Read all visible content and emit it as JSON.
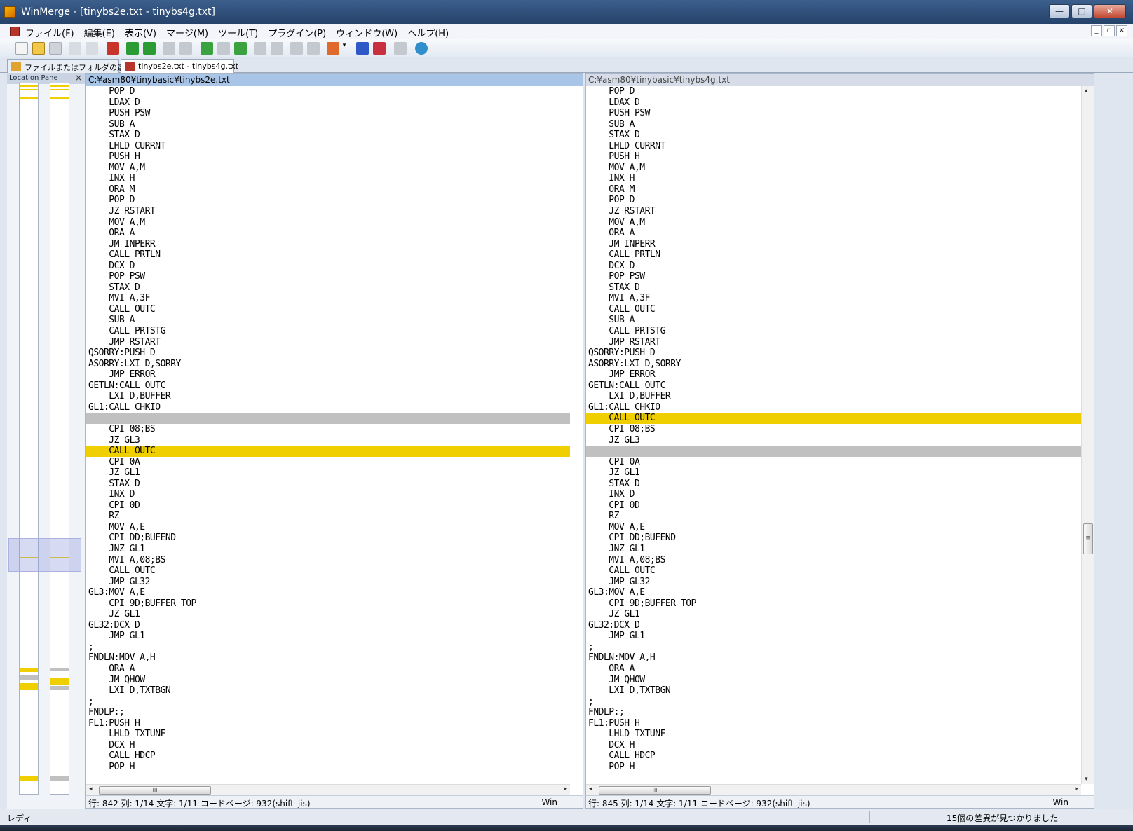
{
  "window": {
    "title": "WinMerge - [tinybs2e.txt - tinybs4g.txt]",
    "minimize": "—",
    "maximize": "□",
    "close": "✕"
  },
  "menu": [
    "ファイル(F)",
    "編集(E)",
    "表示(V)",
    "マージ(M)",
    "ツール(T)",
    "プラグイン(P)",
    "ウィンドウ(W)",
    "ヘルプ(H)"
  ],
  "mdi_buttons": [
    "_",
    "▫",
    "×"
  ],
  "tabs": [
    {
      "label": "ファイルまたはフォルダの選択...",
      "active": false
    },
    {
      "label": "tinybs2e.txt - tinybs4g.txt",
      "active": true
    }
  ],
  "location_pane": {
    "title": "Location Pane",
    "close": "×"
  },
  "left": {
    "path": "C:¥asm80¥tinybasic¥tinybs2e.txt",
    "status": "行: 842  列: 1/14  文字: 1/11  コードページ: 932(shift_jis)",
    "eol": "Win",
    "lines": [
      {
        "t": "    POP D",
        "s": ""
      },
      {
        "t": "    LDAX D",
        "s": ""
      },
      {
        "t": "    PUSH PSW",
        "s": ""
      },
      {
        "t": "    SUB A",
        "s": ""
      },
      {
        "t": "    STAX D",
        "s": ""
      },
      {
        "t": "    LHLD CURRNT",
        "s": ""
      },
      {
        "t": "    PUSH H",
        "s": ""
      },
      {
        "t": "    MOV A,M",
        "s": ""
      },
      {
        "t": "    INX H",
        "s": ""
      },
      {
        "t": "    ORA M",
        "s": ""
      },
      {
        "t": "    POP D",
        "s": ""
      },
      {
        "t": "    JZ RSTART",
        "s": ""
      },
      {
        "t": "    MOV A,M",
        "s": ""
      },
      {
        "t": "    ORA A",
        "s": ""
      },
      {
        "t": "    JM INPERR",
        "s": ""
      },
      {
        "t": "    CALL PRTLN",
        "s": ""
      },
      {
        "t": "    DCX D",
        "s": ""
      },
      {
        "t": "    POP PSW",
        "s": ""
      },
      {
        "t": "    STAX D",
        "s": ""
      },
      {
        "t": "    MVI A,3F",
        "s": ""
      },
      {
        "t": "    CALL OUTC",
        "s": ""
      },
      {
        "t": "    SUB A",
        "s": ""
      },
      {
        "t": "    CALL PRTSTG",
        "s": ""
      },
      {
        "t": "    JMP RSTART",
        "s": ""
      },
      {
        "t": "QSORRY:PUSH D",
        "s": ""
      },
      {
        "t": "ASORRY:LXI D,SORRY",
        "s": ""
      },
      {
        "t": "    JMP ERROR",
        "s": ""
      },
      {
        "t": "GETLN:CALL OUTC",
        "s": ""
      },
      {
        "t": "    LXI D,BUFFER",
        "s": ""
      },
      {
        "t": "GL1:CALL CHKIO",
        "s": ""
      },
      {
        "t": "",
        "s": "empty"
      },
      {
        "t": "    CPI 08;BS",
        "s": ""
      },
      {
        "t": "    JZ GL3",
        "s": ""
      },
      {
        "t": "    CALL OUTC",
        "s": "changed"
      },
      {
        "t": "    CPI 0A",
        "s": ""
      },
      {
        "t": "    JZ GL1",
        "s": ""
      },
      {
        "t": "    STAX D",
        "s": ""
      },
      {
        "t": "    INX D",
        "s": ""
      },
      {
        "t": "    CPI 0D",
        "s": ""
      },
      {
        "t": "    RZ",
        "s": ""
      },
      {
        "t": "    MOV A,E",
        "s": ""
      },
      {
        "t": "    CPI DD;BUFEND",
        "s": ""
      },
      {
        "t": "    JNZ GL1",
        "s": ""
      },
      {
        "t": "    MVI A,08;BS",
        "s": ""
      },
      {
        "t": "    CALL OUTC",
        "s": ""
      },
      {
        "t": "    JMP GL32",
        "s": ""
      },
      {
        "t": "GL3:MOV A,E",
        "s": ""
      },
      {
        "t": "    CPI 9D;BUFFER TOP",
        "s": ""
      },
      {
        "t": "    JZ GL1",
        "s": ""
      },
      {
        "t": "GL32:DCX D",
        "s": ""
      },
      {
        "t": "    JMP GL1",
        "s": ""
      },
      {
        "t": ";",
        "s": ""
      },
      {
        "t": "FNDLN:MOV A,H",
        "s": ""
      },
      {
        "t": "    ORA A",
        "s": ""
      },
      {
        "t": "    JM QHOW",
        "s": ""
      },
      {
        "t": "    LXI D,TXTBGN",
        "s": ""
      },
      {
        "t": ";",
        "s": ""
      },
      {
        "t": "FNDLP:;",
        "s": ""
      },
      {
        "t": "FL1:PUSH H",
        "s": ""
      },
      {
        "t": "    LHLD TXTUNF",
        "s": ""
      },
      {
        "t": "    DCX H",
        "s": ""
      },
      {
        "t": "    CALL HDCP",
        "s": ""
      },
      {
        "t": "    POP H",
        "s": ""
      }
    ]
  },
  "right": {
    "path": "C:¥asm80¥tinybasic¥tinybs4g.txt",
    "status": "行: 845  列: 1/14  文字: 1/11  コードページ: 932(shift_jis)",
    "eol": "Win",
    "lines": [
      {
        "t": "    POP D",
        "s": ""
      },
      {
        "t": "    LDAX D",
        "s": ""
      },
      {
        "t": "    PUSH PSW",
        "s": ""
      },
      {
        "t": "    SUB A",
        "s": ""
      },
      {
        "t": "    STAX D",
        "s": ""
      },
      {
        "t": "    LHLD CURRNT",
        "s": ""
      },
      {
        "t": "    PUSH H",
        "s": ""
      },
      {
        "t": "    MOV A,M",
        "s": ""
      },
      {
        "t": "    INX H",
        "s": ""
      },
      {
        "t": "    ORA M",
        "s": ""
      },
      {
        "t": "    POP D",
        "s": ""
      },
      {
        "t": "    JZ RSTART",
        "s": ""
      },
      {
        "t": "    MOV A,M",
        "s": ""
      },
      {
        "t": "    ORA A",
        "s": ""
      },
      {
        "t": "    JM INPERR",
        "s": ""
      },
      {
        "t": "    CALL PRTLN",
        "s": ""
      },
      {
        "t": "    DCX D",
        "s": ""
      },
      {
        "t": "    POP PSW",
        "s": ""
      },
      {
        "t": "    STAX D",
        "s": ""
      },
      {
        "t": "    MVI A,3F",
        "s": ""
      },
      {
        "t": "    CALL OUTC",
        "s": ""
      },
      {
        "t": "    SUB A",
        "s": ""
      },
      {
        "t": "    CALL PRTSTG",
        "s": ""
      },
      {
        "t": "    JMP RSTART",
        "s": ""
      },
      {
        "t": "QSORRY:PUSH D",
        "s": ""
      },
      {
        "t": "ASORRY:LXI D,SORRY",
        "s": ""
      },
      {
        "t": "    JMP ERROR",
        "s": ""
      },
      {
        "t": "GETLN:CALL OUTC",
        "s": ""
      },
      {
        "t": "    LXI D,BUFFER",
        "s": ""
      },
      {
        "t": "GL1:CALL CHKIO",
        "s": ""
      },
      {
        "t": "    CALL OUTC",
        "s": "changed"
      },
      {
        "t": "    CPI 08;BS",
        "s": ""
      },
      {
        "t": "    JZ GL3",
        "s": ""
      },
      {
        "t": "",
        "s": "empty"
      },
      {
        "t": "    CPI 0A",
        "s": ""
      },
      {
        "t": "    JZ GL1",
        "s": ""
      },
      {
        "t": "    STAX D",
        "s": ""
      },
      {
        "t": "    INX D",
        "s": ""
      },
      {
        "t": "    CPI 0D",
        "s": ""
      },
      {
        "t": "    RZ",
        "s": ""
      },
      {
        "t": "    MOV A,E",
        "s": ""
      },
      {
        "t": "    CPI DD;BUFEND",
        "s": ""
      },
      {
        "t": "    JNZ GL1",
        "s": ""
      },
      {
        "t": "    MVI A,08;BS",
        "s": ""
      },
      {
        "t": "    CALL OUTC",
        "s": ""
      },
      {
        "t": "    JMP GL32",
        "s": ""
      },
      {
        "t": "GL3:MOV A,E",
        "s": ""
      },
      {
        "t": "    CPI 9D;BUFFER TOP",
        "s": ""
      },
      {
        "t": "    JZ GL1",
        "s": ""
      },
      {
        "t": "GL32:DCX D",
        "s": ""
      },
      {
        "t": "    JMP GL1",
        "s": ""
      },
      {
        "t": ";",
        "s": ""
      },
      {
        "t": "FNDLN:MOV A,H",
        "s": ""
      },
      {
        "t": "    ORA A",
        "s": ""
      },
      {
        "t": "    JM QHOW",
        "s": ""
      },
      {
        "t": "    LXI D,TXTBGN",
        "s": ""
      },
      {
        "t": ";",
        "s": ""
      },
      {
        "t": "FNDLP:;",
        "s": ""
      },
      {
        "t": "FL1:PUSH H",
        "s": ""
      },
      {
        "t": "    LHLD TXTUNF",
        "s": ""
      },
      {
        "t": "    DCX H",
        "s": ""
      },
      {
        "t": "    CALL HDCP",
        "s": ""
      },
      {
        "t": "    POP H",
        "s": ""
      }
    ]
  },
  "scrollbar": {
    "thumb_grip": "≡",
    "hthumb_grip": "III",
    "left_arrow": "◂",
    "right_arrow": "▸",
    "up_arrow": "▴",
    "down_arrow": "▾"
  },
  "statusbar": {
    "ready": "レディ",
    "message": "15個の差異が見つかりました"
  },
  "colors": {
    "changed": "#f0cf00",
    "empty": "#c0c0c0"
  }
}
